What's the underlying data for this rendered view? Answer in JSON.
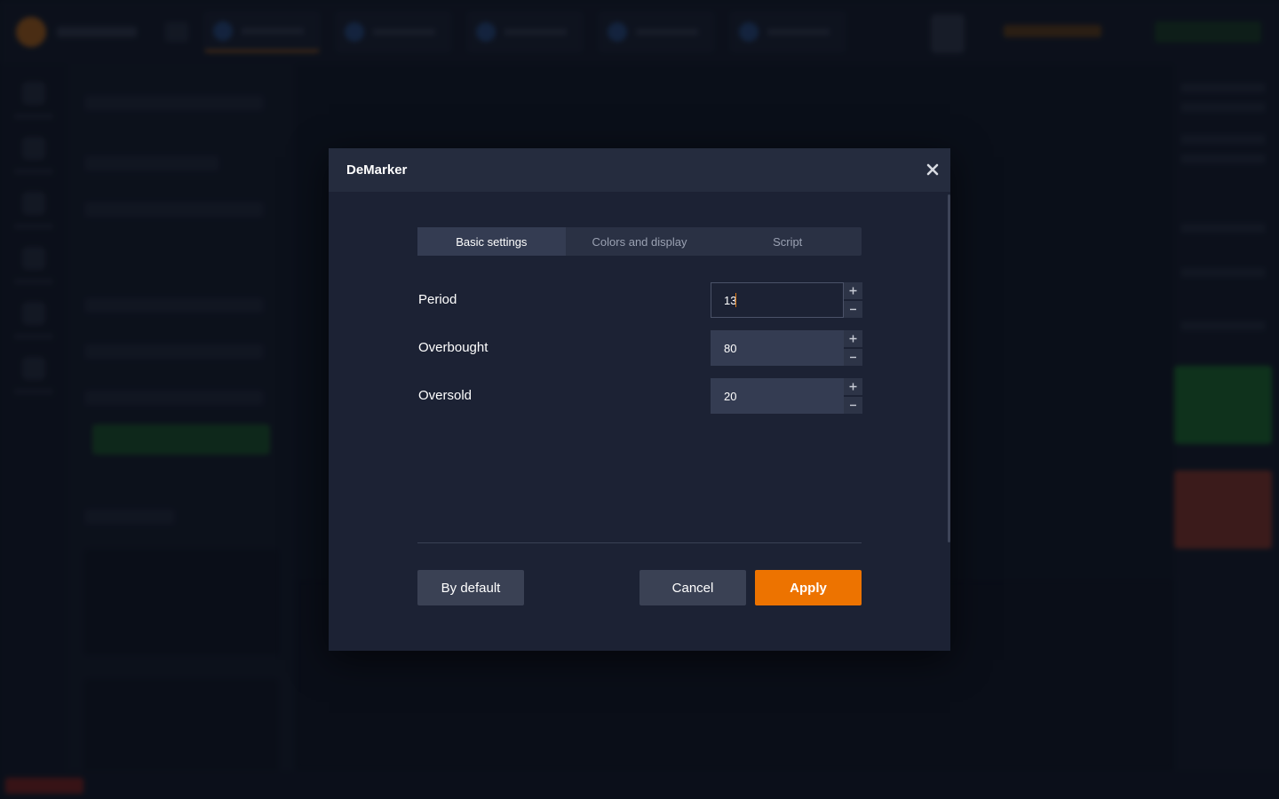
{
  "dialog": {
    "title": "DeMarker",
    "close_icon": "close-icon",
    "tabs": [
      {
        "label": "Basic settings",
        "active": true
      },
      {
        "label": "Colors and display",
        "active": false
      },
      {
        "label": "Script",
        "active": false
      }
    ],
    "fields": [
      {
        "label": "Period",
        "value": "13",
        "focused": true
      },
      {
        "label": "Overbought",
        "value": "80",
        "focused": false
      },
      {
        "label": "Oversold",
        "value": "20",
        "focused": false
      }
    ],
    "buttons": {
      "default_label": "By default",
      "cancel_label": "Cancel",
      "apply_label": "Apply"
    }
  },
  "colors": {
    "accent": "#ed7300",
    "dialog_bg": "#1c2234",
    "header_bg": "#252c3e",
    "input_bg": "#343c52"
  }
}
